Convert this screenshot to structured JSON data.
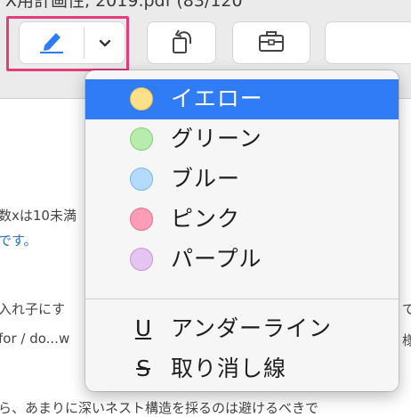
{
  "window": {
    "title_fragment": "X用計画性, 2019.pdf (83/120"
  },
  "toolbar": {
    "highlight_button": {
      "icon": "highlighter-pen-icon",
      "color": "#2c7cf6"
    },
    "highlight_menu_button": {
      "icon": "chevron-down-icon"
    },
    "rotate_button": {
      "icon": "rotate-left-icon"
    },
    "toolbox_button": {
      "icon": "toolbox-icon"
    }
  },
  "document": {
    "lines": [
      {
        "text": "数xは10未満"
      },
      {
        "text": "です。",
        "link": true
      },
      {
        "text": "入れ子にす",
        "right": "で"
      },
      {
        "text": "for / do...w",
        "right": "様"
      },
      {
        "text": "ら、あまりに深いネスト構造を採るのは避けるべきで"
      }
    ]
  },
  "highlight_menu": {
    "colors": [
      {
        "label": "イエロー",
        "swatch": "#ffe08a",
        "border": "#e8c24e",
        "selected": true
      },
      {
        "label": "グリーン",
        "swatch": "#b8ecad",
        "border": "#86cf78",
        "selected": false
      },
      {
        "label": "ブルー",
        "swatch": "#b4dafc",
        "border": "#7db7ea",
        "selected": false
      },
      {
        "label": "ピンク",
        "swatch": "#ff9db8",
        "border": "#e8708f",
        "selected": false
      },
      {
        "label": "パープル",
        "swatch": "#e6c4f2",
        "border": "#c795da",
        "selected": false
      }
    ],
    "styles": [
      {
        "symbol": "U",
        "label": "アンダーライン",
        "kind": "underline"
      },
      {
        "symbol": "S",
        "label": "取り消し線",
        "kind": "strikethrough"
      }
    ]
  }
}
